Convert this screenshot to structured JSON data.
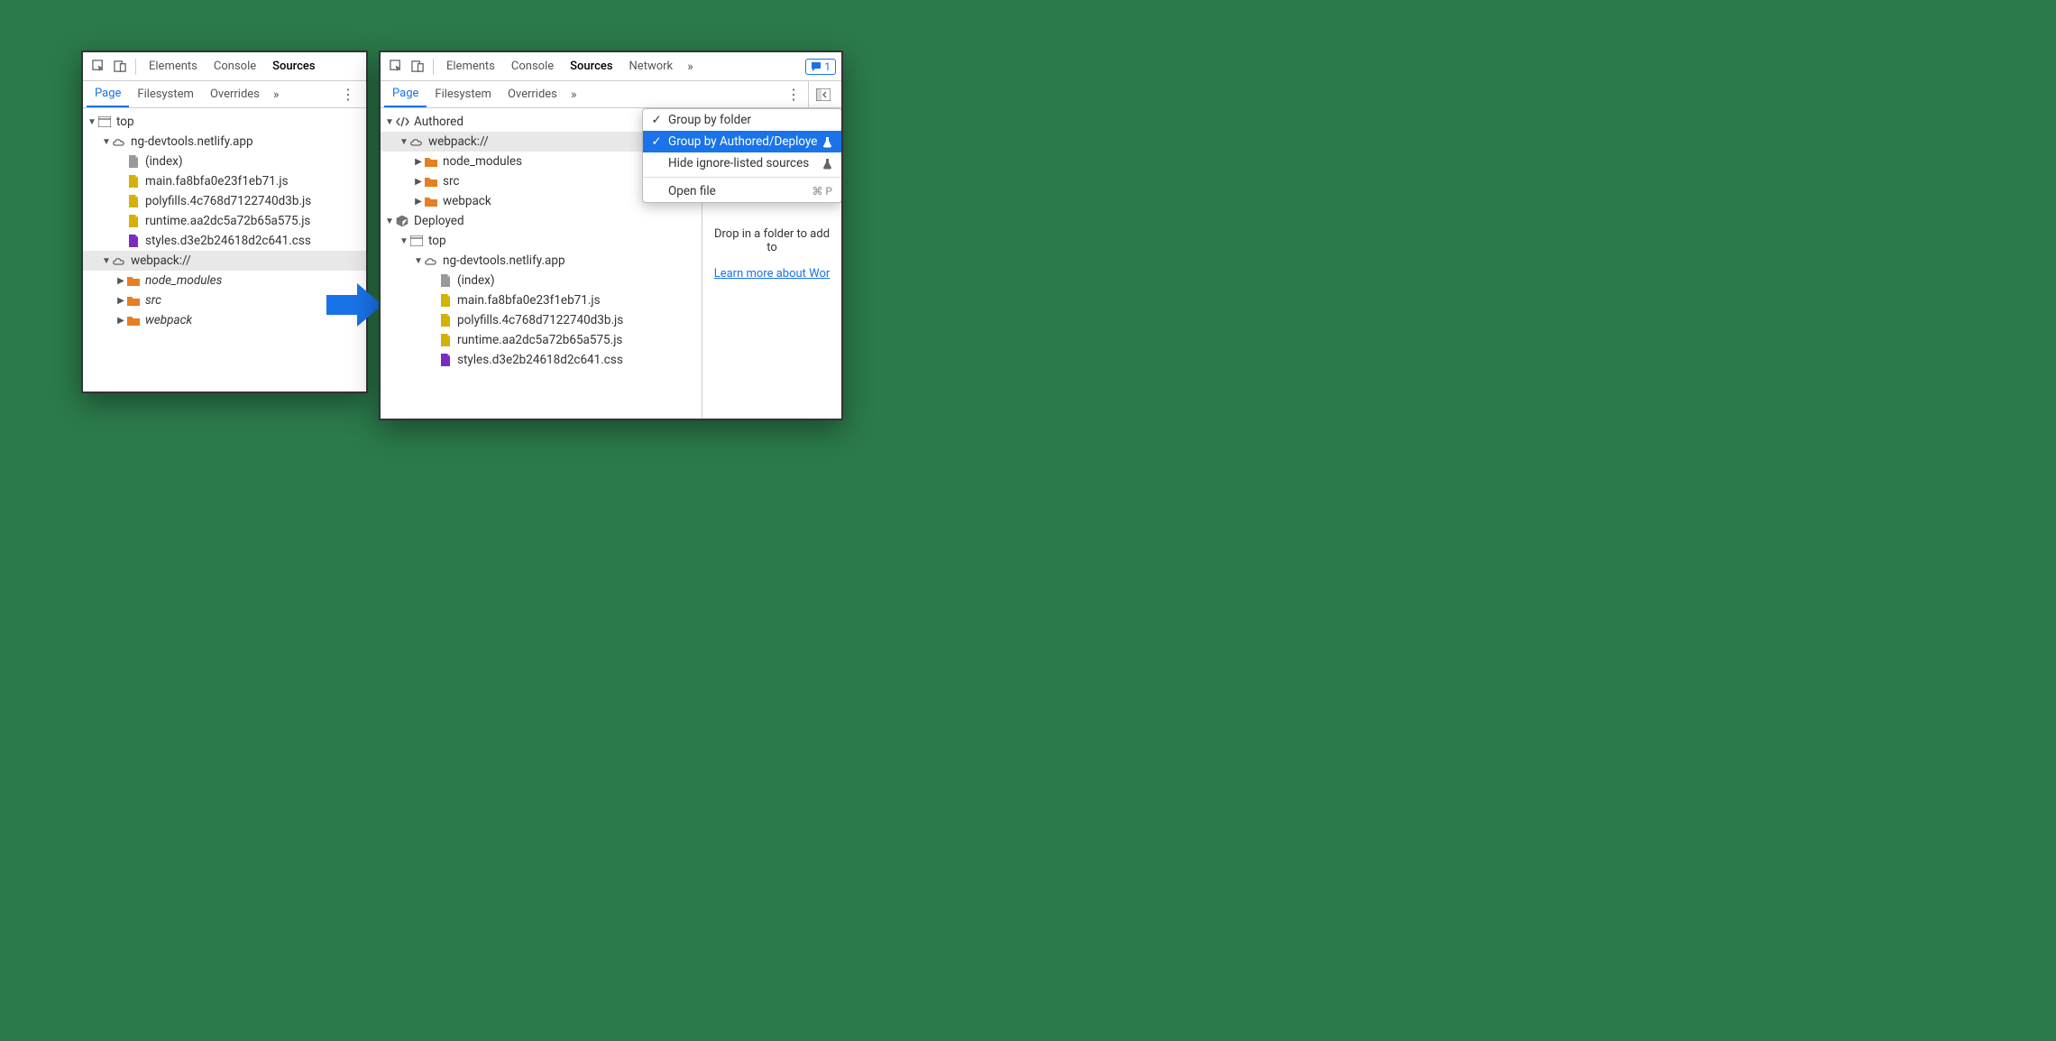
{
  "mainTabs": {
    "elements": "Elements",
    "console": "Console",
    "sources": "Sources",
    "network": "Network"
  },
  "subTabs": {
    "page": "Page",
    "filesystem": "Filesystem",
    "overrides": "Overrides"
  },
  "issuesCount": "1",
  "leftTree": {
    "top": "top",
    "domain": "ng-devtools.netlify.app",
    "index": "(index)",
    "mainjs": "main.fa8bfa0e23f1eb71.js",
    "polyfills": "polyfills.4c768d7122740d3b.js",
    "runtime": "runtime.aa2dc5a72b65a575.js",
    "styles": "styles.d3e2b24618d2c641.css",
    "webpack": "webpack://",
    "node_modules": "node_modules",
    "src": "src",
    "webpack_folder": "webpack"
  },
  "rightTree": {
    "authored": "Authored",
    "webpack": "webpack://",
    "node_modules": "node_modules",
    "src": "src",
    "webpack_folder": "webpack",
    "deployed": "Deployed",
    "top": "top",
    "domain": "ng-devtools.netlify.app",
    "index": "(index)",
    "mainjs": "main.fa8bfa0e23f1eb71.js",
    "polyfills": "polyfills.4c768d7122740d3b.js",
    "runtime": "runtime.aa2dc5a72b65a575.js",
    "styles": "styles.d3e2b24618d2c641.css"
  },
  "menu": {
    "groupFolder": "Group by folder",
    "groupAuthored": "Group by Authored/Deployed",
    "hideIgnore": "Hide ignore-listed sources",
    "openFile": "Open file",
    "openShortcut": "⌘ P"
  },
  "editorHint": {
    "drop": "Drop in a folder to add to",
    "link": "Learn more about Wor"
  }
}
